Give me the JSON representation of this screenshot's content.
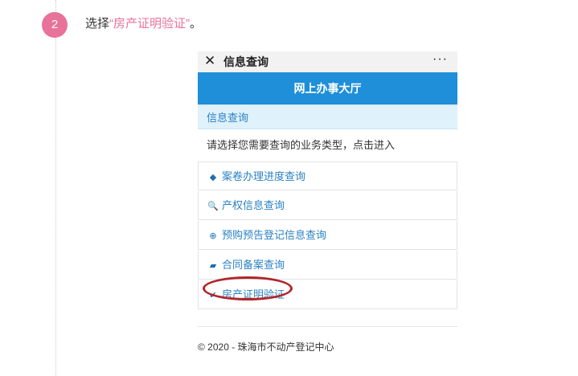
{
  "step": {
    "number": "2",
    "text_prefix": "选择",
    "highlight": "“房产证明验证”",
    "text_suffix": "。"
  },
  "app": {
    "close_glyph": "✕",
    "title": "信息查询",
    "more_glyph": "···",
    "header": "网上办事大厅",
    "section": "信息查询",
    "prompt": "请选择您需要查询的业务类型，点击进入",
    "items": [
      {
        "icon": "tag-icon",
        "glyph": "◆",
        "label": "案卷办理进度查询"
      },
      {
        "icon": "search-icon",
        "glyph": "🔍",
        "label": "产权信息查询"
      },
      {
        "icon": "zoom-in-icon",
        "glyph": "⊕",
        "label": "预购预告登记信息查询"
      },
      {
        "icon": "book-icon",
        "glyph": "▰",
        "label": "合同备案查询"
      },
      {
        "icon": "check-icon",
        "glyph": "✔",
        "label": "房产证明验证"
      }
    ],
    "footer": "© 2020 - 珠海市不动产登记中心"
  },
  "colors": {
    "accent_pink": "#e8729a",
    "header_blue": "#1e8fd8",
    "link_blue": "#2b82c4",
    "annotation_red": "#b0262a"
  }
}
